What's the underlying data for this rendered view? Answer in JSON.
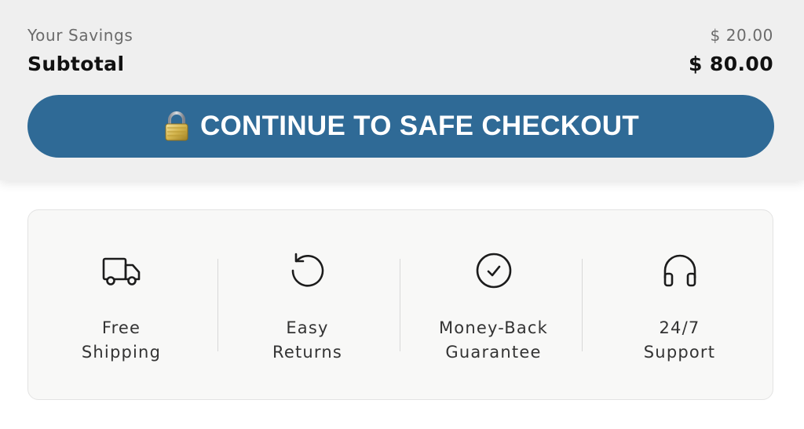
{
  "summary": {
    "savings_label": "Your Savings",
    "savings_value": "$ 20.00",
    "subtotal_label": "Subtotal",
    "subtotal_value": "$ 80.00"
  },
  "checkout": {
    "label": "CONTINUE TO SAFE CHECKOUT",
    "icon": "lock-icon",
    "color": "#2f6a96"
  },
  "features": [
    {
      "line1": "Free",
      "line2": "Shipping",
      "icon": "truck-icon"
    },
    {
      "line1": "Easy",
      "line2": "Returns",
      "icon": "return-arrow-icon"
    },
    {
      "line1": "Money-Back",
      "line2": "Guarantee",
      "icon": "check-circle-icon"
    },
    {
      "line1": "24/7",
      "line2": "Support",
      "icon": "headphones-icon"
    }
  ]
}
